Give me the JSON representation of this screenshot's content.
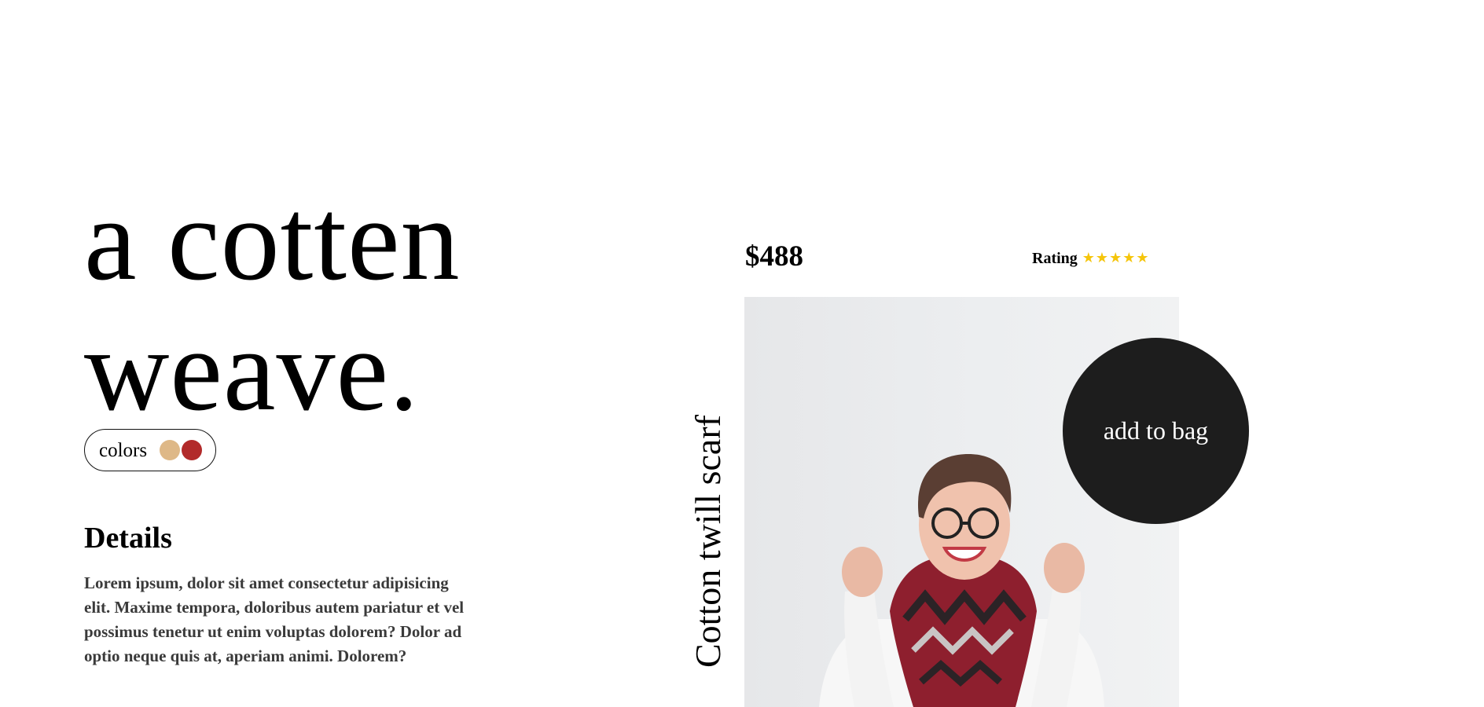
{
  "headline": {
    "line1": "a cotten",
    "line2": "weave."
  },
  "colors": {
    "label": "colors",
    "swatches": [
      {
        "name": "tan",
        "hex": "#deb887"
      },
      {
        "name": "red",
        "hex": "#b22a2a"
      }
    ]
  },
  "details": {
    "heading": "Details",
    "body": "Lorem ipsum, dolor sit amet consectetur adipisicing elit. Maxime tempora, doloribus autem pariatur et vel possimus tenetur ut enim voluptas dolorem? Dolor ad optio neque quis at, aperiam animi. Dolorem?"
  },
  "product": {
    "price": "$488",
    "rating_label": "Rating",
    "rating_stars": "★★★★★",
    "rating_value": 5,
    "rating_max": 5,
    "name": "Cotton twill scarf",
    "add_to_bag_label": "add to bag",
    "photo_icon": "product-photo-woman-scarf"
  },
  "theme": {
    "accent_dark": "#1d1d1d",
    "star_color": "#f5c50b"
  }
}
